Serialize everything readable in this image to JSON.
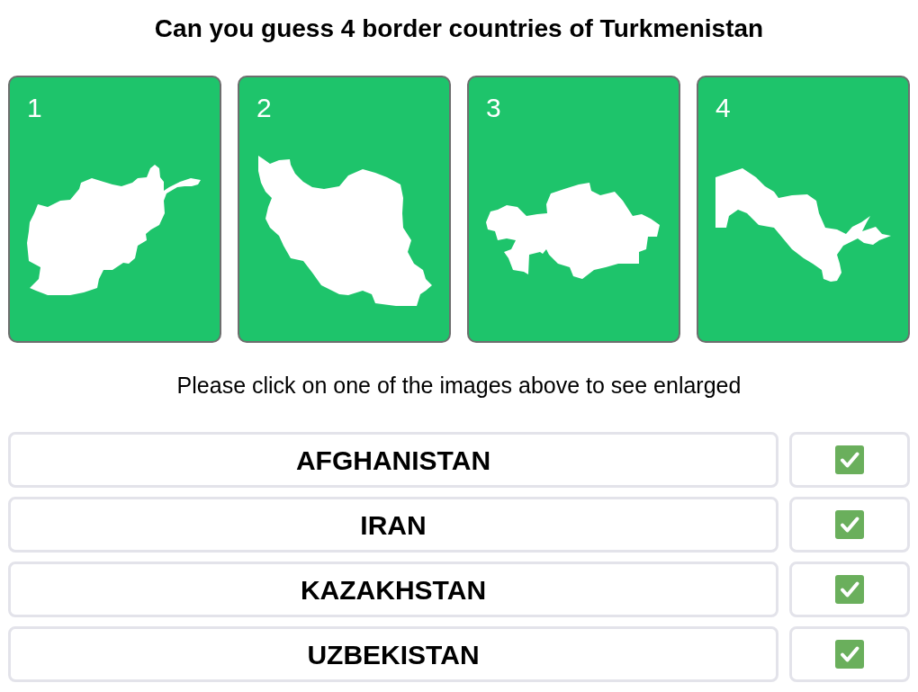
{
  "title": "Can you guess 4 border countries of Turkmenistan",
  "cards": [
    {
      "number": "1"
    },
    {
      "number": "2"
    },
    {
      "number": "3"
    },
    {
      "number": "4"
    }
  ],
  "instruction": "Please click on one of the images above to see enlarged",
  "answers": [
    {
      "name": "AFGHANISTAN",
      "correct": true
    },
    {
      "name": "IRAN",
      "correct": true
    },
    {
      "name": "KAZAKHSTAN",
      "correct": true
    },
    {
      "name": "UZBEKISTAN",
      "correct": true
    }
  ]
}
